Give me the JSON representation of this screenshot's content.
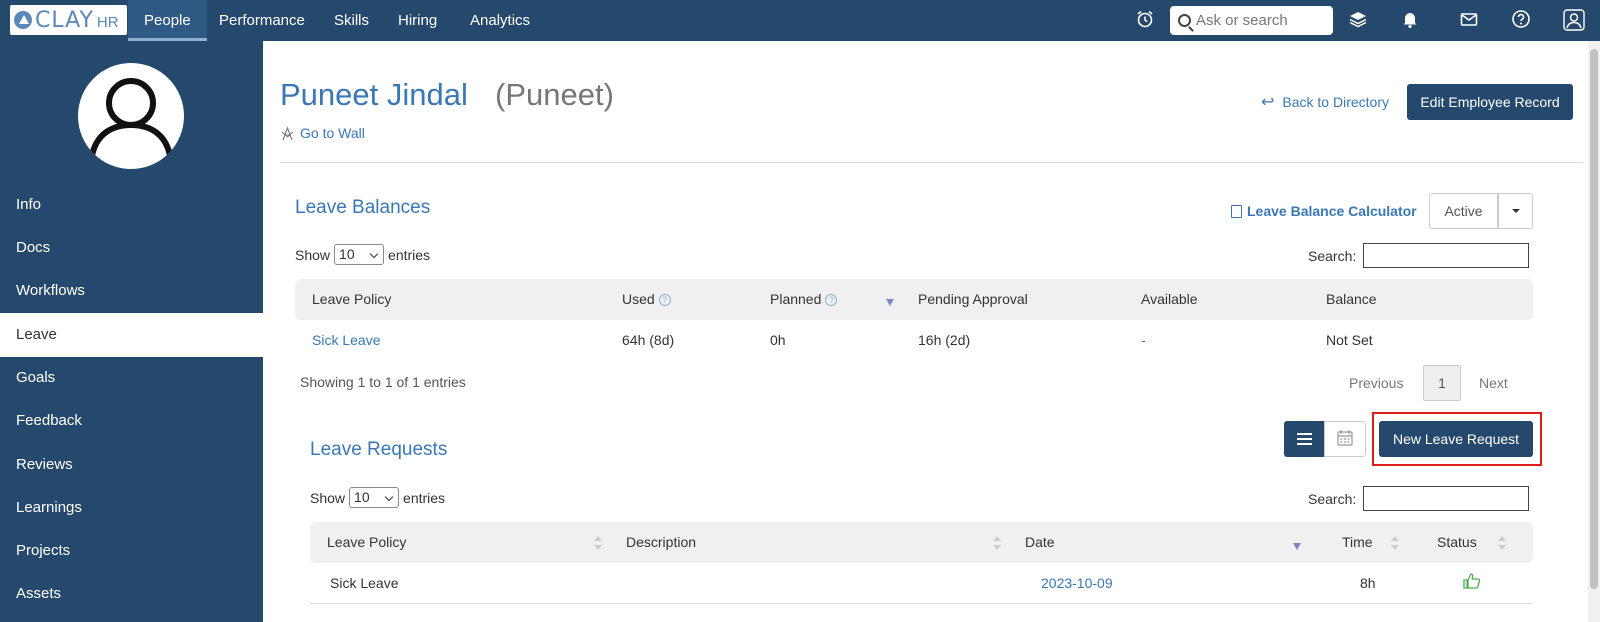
{
  "topnav": {
    "logo": "CLAY",
    "logo_sub": "HR",
    "items": [
      "People",
      "Performance",
      "Skills",
      "Hiring",
      "Analytics"
    ],
    "search_placeholder": "Ask or search"
  },
  "sidebar": {
    "items": [
      "Info",
      "Docs",
      "Workflows",
      "Leave",
      "Goals",
      "Feedback",
      "Reviews",
      "Learnings",
      "Projects",
      "Assets"
    ],
    "active": "Leave"
  },
  "header": {
    "name": "Puneet Jindal",
    "nickname": "(Puneet)",
    "go_to_wall": "Go to Wall",
    "back": "Back to Directory",
    "edit": "Edit Employee Record"
  },
  "leave_balances": {
    "title": "Leave Balances",
    "calculator": "Leave Balance Calculator",
    "filter": "Active",
    "show": "Show",
    "entries_count": "10",
    "entries": "entries",
    "search_label": "Search:",
    "columns": [
      "Leave Policy",
      "Used",
      "Planned",
      "Pending Approval",
      "Available",
      "Balance"
    ],
    "rows": [
      {
        "policy": "Sick Leave",
        "used": "64h (8d)",
        "planned": "0h",
        "pending": "16h (2d)",
        "available": "-",
        "balance": "Not Set"
      }
    ],
    "showing": "Showing 1 to 1 of 1 entries",
    "prev": "Previous",
    "page": "1",
    "next": "Next"
  },
  "leave_requests": {
    "title": "Leave Requests",
    "new_button": "New Leave Request",
    "show": "Show",
    "entries_count": "10",
    "entries": "entries",
    "search_label": "Search:",
    "columns": [
      "Leave Policy",
      "Description",
      "Date",
      "Time",
      "Status"
    ],
    "rows": [
      {
        "policy": "Sick Leave",
        "description": "",
        "date": "2023-10-09",
        "time": "8h",
        "status": "approved"
      }
    ]
  },
  "colors": {
    "navy": "#25496d",
    "link": "#3a78b5",
    "highlight": "#e01b1b",
    "approved": "#4caf50"
  }
}
